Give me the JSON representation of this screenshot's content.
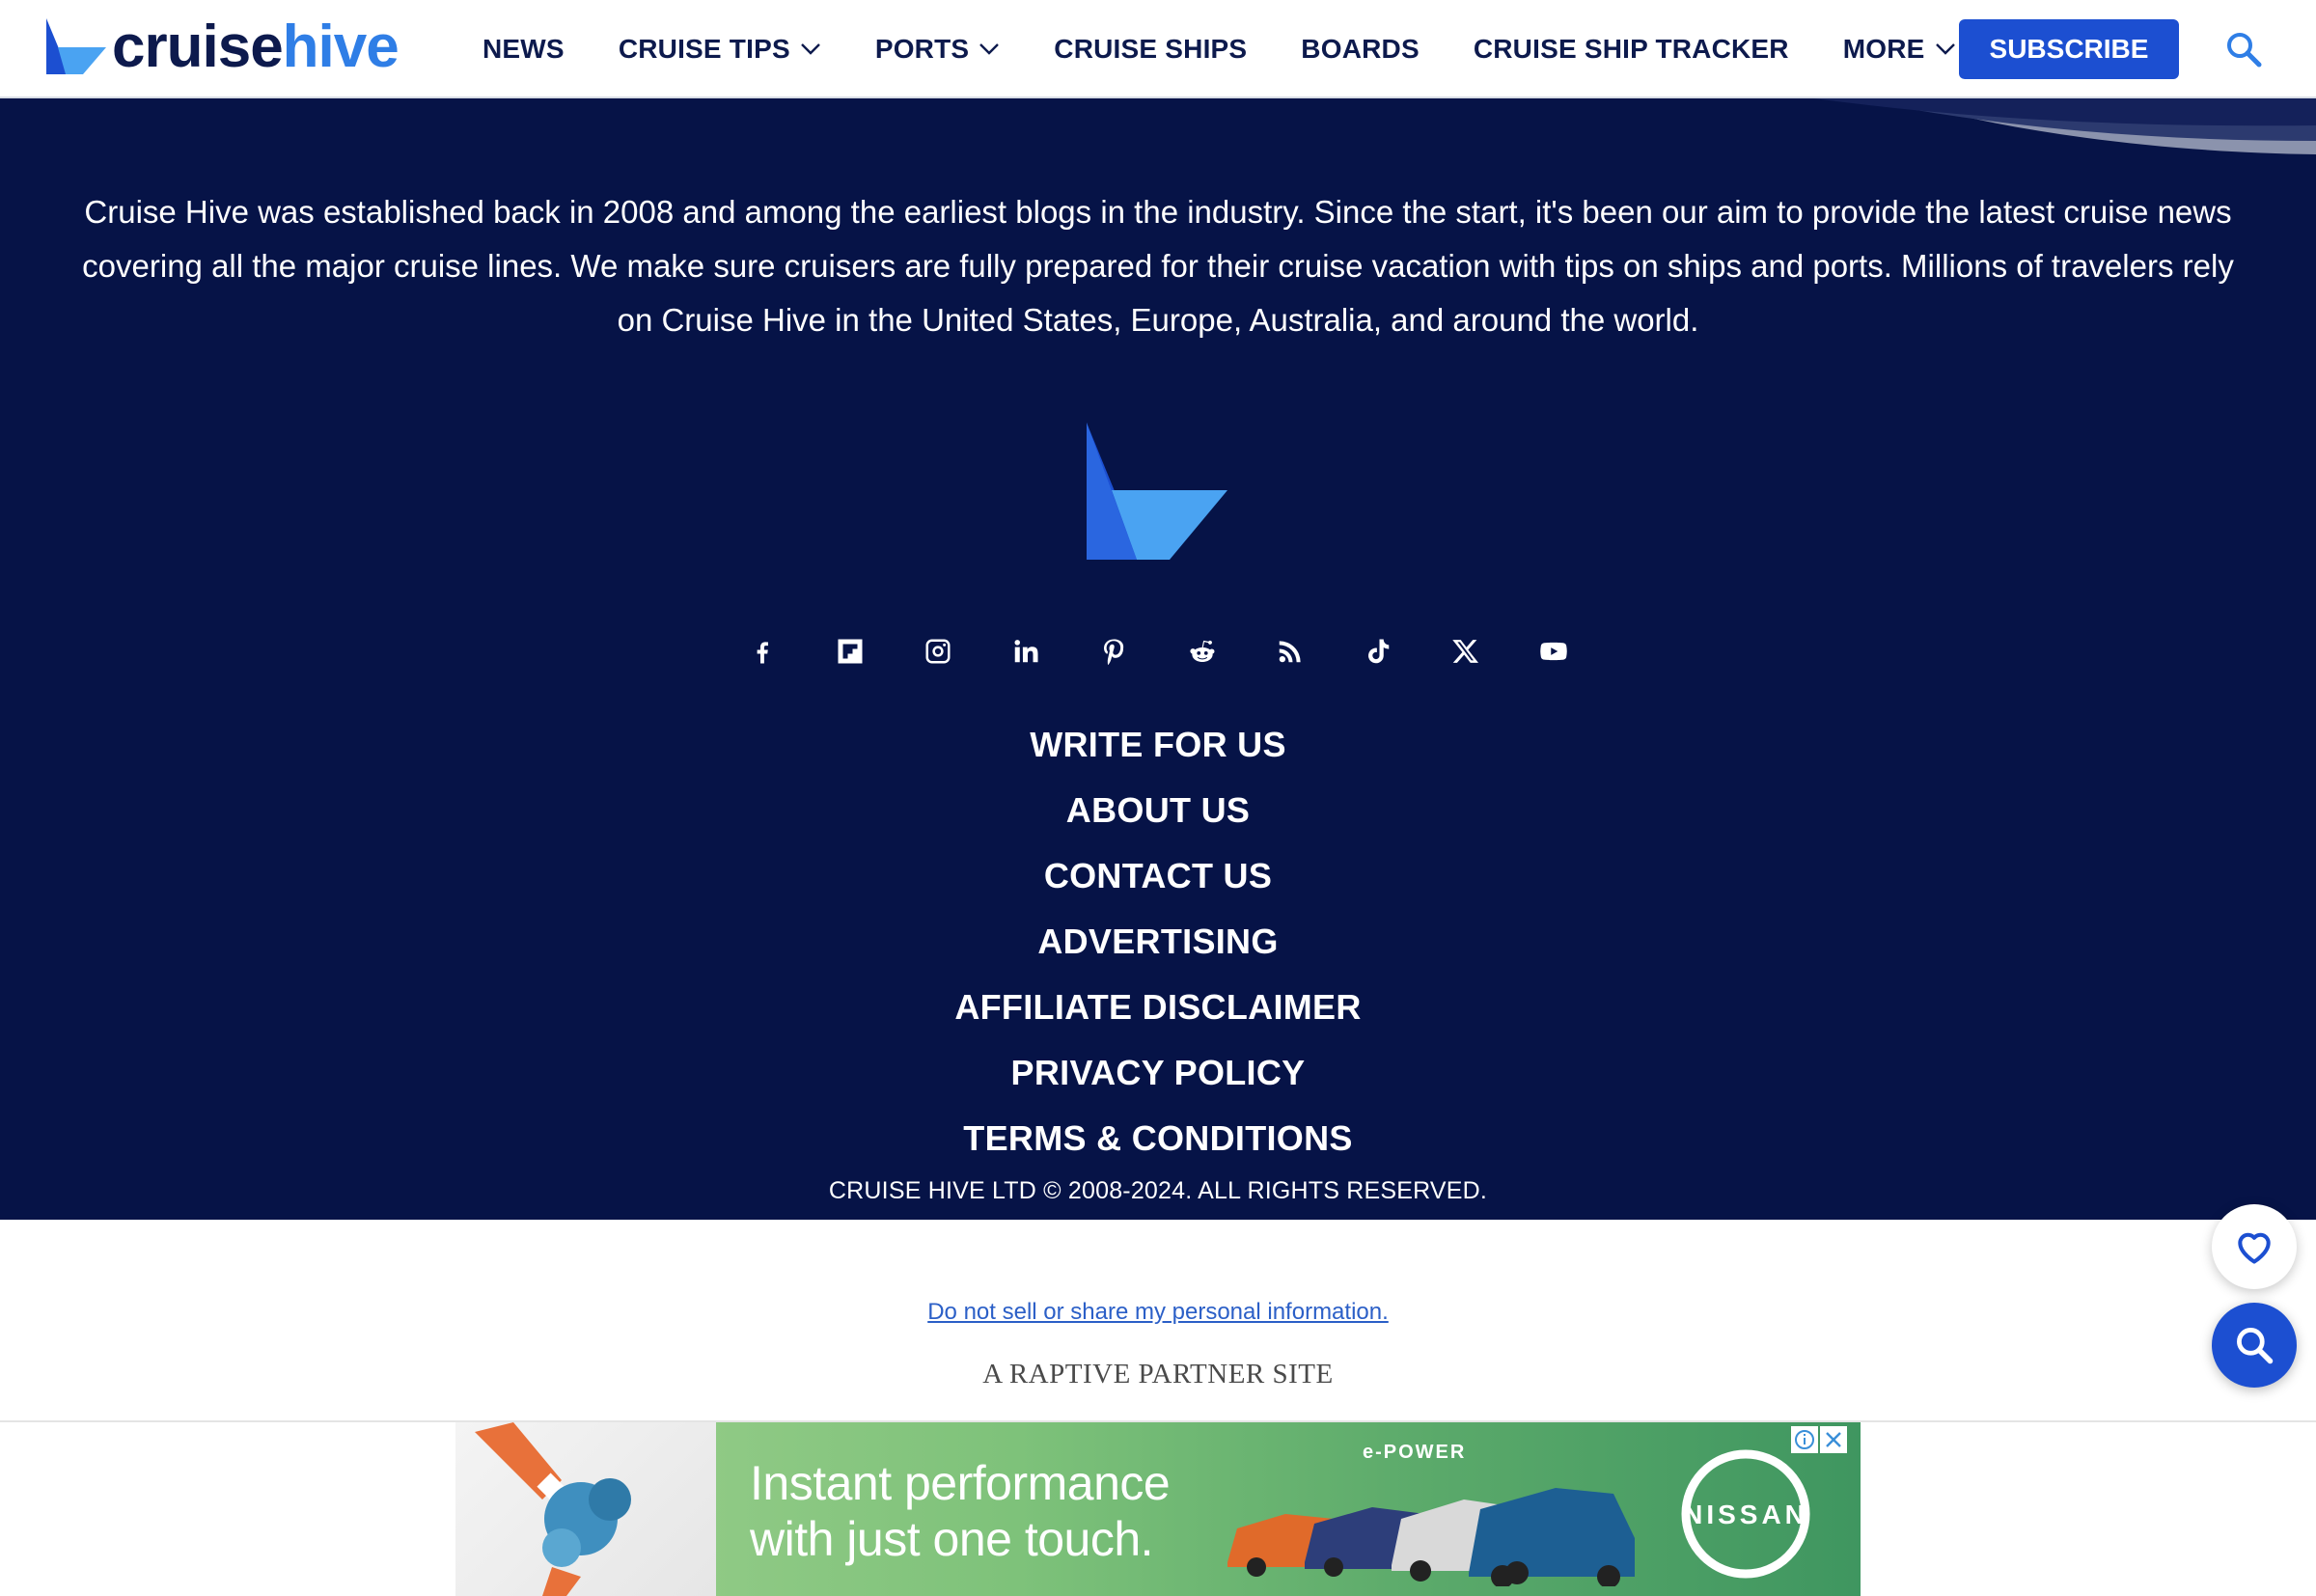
{
  "header": {
    "logo": {
      "part1": "cruise",
      "part2": "hive"
    },
    "nav": [
      {
        "label": "NEWS",
        "dropdown": false
      },
      {
        "label": "CRUISE TIPS",
        "dropdown": true
      },
      {
        "label": "PORTS",
        "dropdown": true
      },
      {
        "label": "CRUISE SHIPS",
        "dropdown": false
      },
      {
        "label": "BOARDS",
        "dropdown": false
      },
      {
        "label": "CRUISE SHIP TRACKER",
        "dropdown": false
      },
      {
        "label": "MORE",
        "dropdown": true
      }
    ],
    "subscribe_label": "SUBSCRIBE"
  },
  "footer": {
    "about": "Cruise Hive was established back in 2008 and among the earliest blogs in the industry. Since the start, it's been our aim to provide the latest cruise news covering all the major cruise lines. We make sure cruisers are fully prepared for their cruise vacation with tips on ships and ports. Millions of travelers rely on Cruise Hive in the United States, Europe, Australia, and around the world.",
    "socials": [
      "facebook-icon",
      "flipboard-icon",
      "instagram-icon",
      "linkedin-icon",
      "pinterest-icon",
      "reddit-icon",
      "rss-icon",
      "tiktok-icon",
      "x-icon",
      "youtube-icon"
    ],
    "links": [
      "WRITE FOR US",
      "ABOUT US",
      "CONTACT US",
      "ADVERTISING",
      "AFFILIATE DISCLAIMER",
      "PRIVACY POLICY",
      "TERMS & CONDITIONS"
    ],
    "copyright": "CRUISE HIVE LTD © 2008-2024. ALL RIGHTS RESERVED."
  },
  "bottom": {
    "dns_link": "Do not sell or share my personal information.",
    "partner": "A RAPTIVE PARTNER SITE"
  },
  "ad": {
    "line1": "Instant performance",
    "line2": "with just one touch.",
    "tag": "e-POWER",
    "brand": "NISSAN"
  },
  "colors": {
    "navy": "#061347",
    "brand_blue": "#1c4fd1",
    "logo_light_blue": "#2f7ee6",
    "nav_text": "#0d1a4d"
  }
}
